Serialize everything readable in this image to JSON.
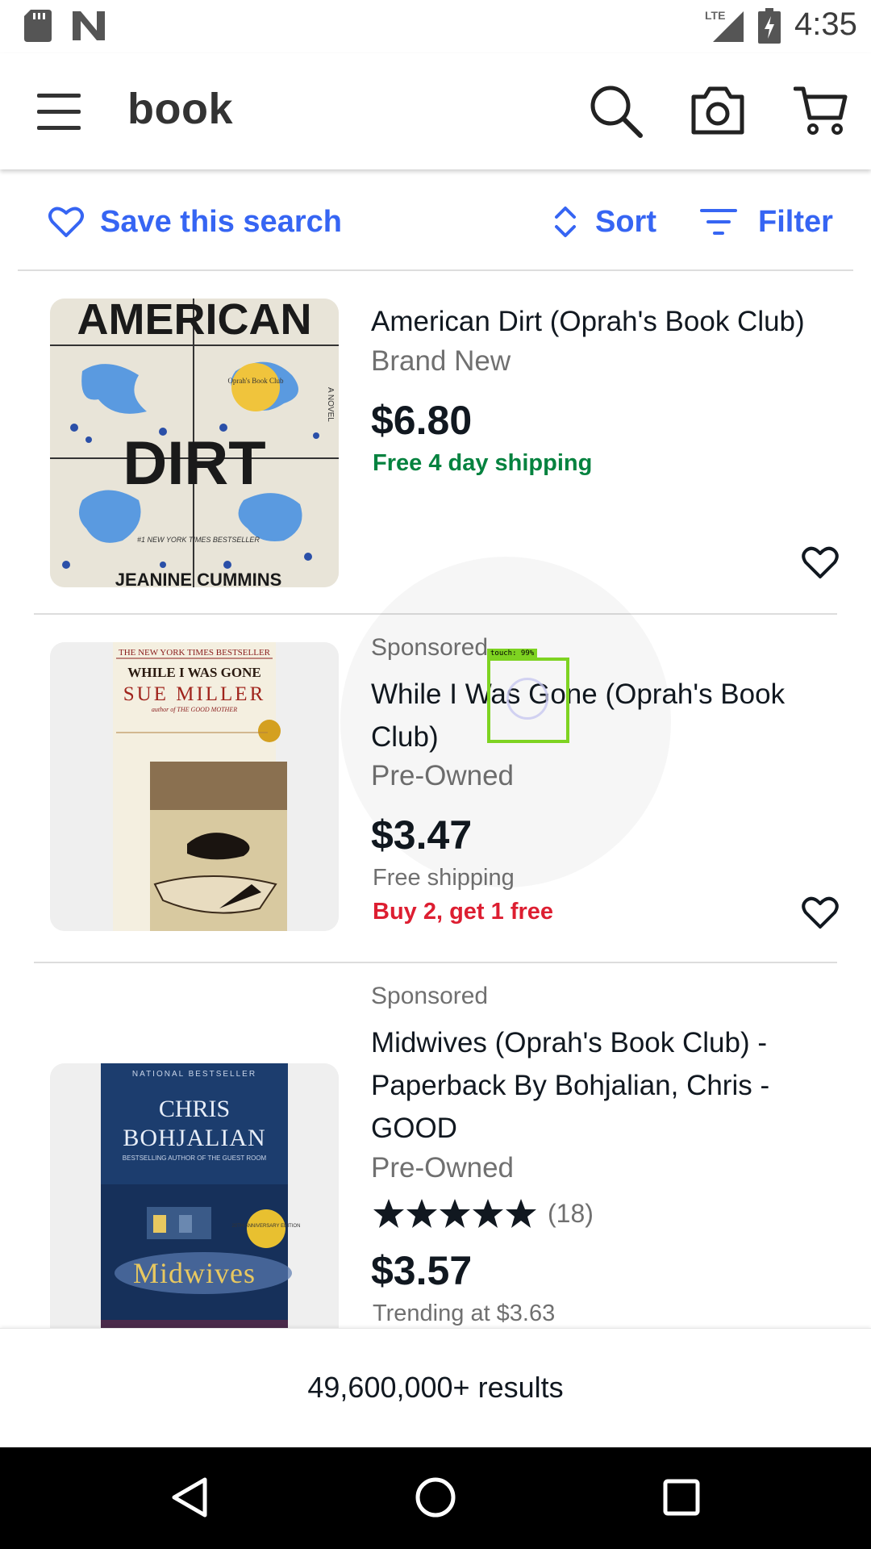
{
  "status_bar": {
    "time": "4:35",
    "network": "LTE"
  },
  "app_bar": {
    "query": "book"
  },
  "filter_bar": {
    "save_search": "Save this search",
    "sort": "Sort",
    "filter": "Filter"
  },
  "listings": [
    {
      "title": "American Dirt (Oprah's Book Club)",
      "condition": "Brand New",
      "price": "$6.80",
      "shipping": "Free 4 day shipping",
      "cover": {
        "top": "AMERICAN",
        "bottom": "DIRT",
        "badge": "Oprah's Book Club",
        "blurb": "#1 NEW YORK TIMES BESTSELLER",
        "author": "JEANINE CUMMINS",
        "side": "A NOVEL"
      }
    },
    {
      "sponsored": "Sponsored",
      "title": "While I Was Gone (Oprah's Book Club)",
      "condition": "Pre-Owned",
      "price": "$3.47",
      "shipping": "Free shipping",
      "promo": "Buy 2, get 1 free",
      "cover": {
        "banner": "THE NEW YORK TIMES BESTSELLER",
        "title": "WHILE I WAS GONE",
        "author": "SUE MILLER",
        "sub": "author of THE GOOD MOTHER"
      }
    },
    {
      "sponsored": "Sponsored",
      "title": "Midwives (Oprah's Book Club) - Paperback By Bohjalian, Chris - GOOD",
      "condition": "Pre-Owned",
      "rating": 5,
      "review_count": "(18)",
      "price": "$3.57",
      "trending": "Trending at $3.63",
      "cover": {
        "banner": "NATIONAL BESTSELLER",
        "author_first": "CHRIS",
        "author_last": "BOHJALIAN",
        "sub": "BESTSELLING AUTHOR OF THE GUEST ROOM",
        "badge": "20TH ANNIVERSARY EDITION",
        "title": "Midwives"
      }
    }
  ],
  "touch": {
    "label": "touch: 99%"
  },
  "results": "49,600,000+ results",
  "colors": {
    "accent": "#3665f3",
    "green": "#05823f",
    "red": "#dd1e31",
    "text": "#111820",
    "muted": "#707070"
  },
  "icons": [
    "sd-card-icon",
    "n-icon",
    "signal-icon",
    "battery-icon",
    "menu-icon",
    "search-icon",
    "camera-icon",
    "cart-icon",
    "heart-icon",
    "sort-icon",
    "filter-icon",
    "star-icon",
    "back-icon",
    "home-icon",
    "recents-icon"
  ]
}
